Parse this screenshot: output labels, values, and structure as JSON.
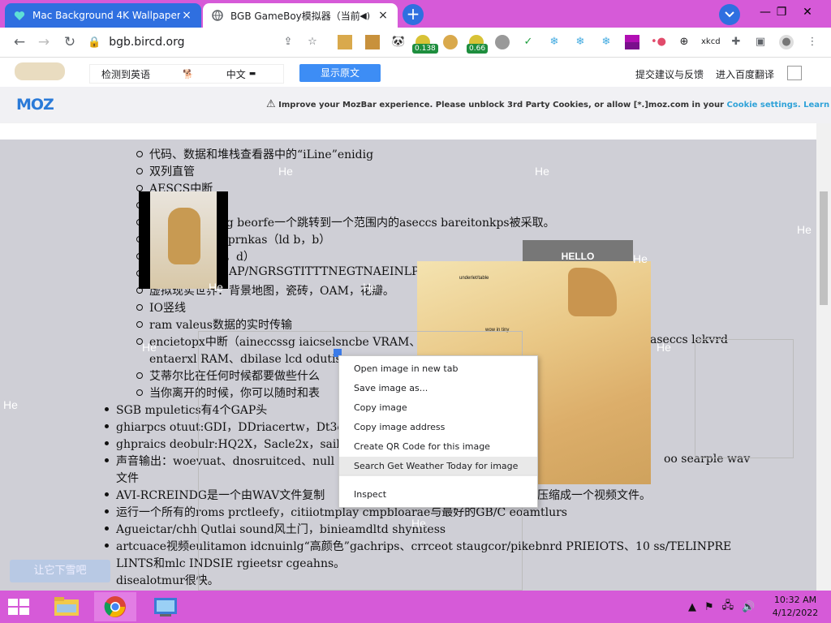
{
  "tabs": [
    {
      "title": "Mac Background 4K Wallpaper N",
      "close": "×"
    },
    {
      "title": "BGB GameBoy模拟器（当前",
      "close": "×"
    }
  ],
  "newtab_label": "+",
  "window_controls": {
    "minimize": "—",
    "restore": "❐",
    "close": "✕"
  },
  "toolbar": {
    "url": "bgb.bircd.org",
    "badges": [
      "0.138",
      "0.66"
    ]
  },
  "translate_bar": {
    "source": "检测到英语",
    "target": "中文",
    "show_original": "显示原文",
    "feedback": "提交建议与反馈",
    "baidu": "进入百度翻译"
  },
  "mozbar": {
    "logo": "MOZ",
    "message": "Improve your MozBar experience. Please unblock 3rd Party Cookies, or allow [*.]moz.com in your",
    "link1": "Cookie settings.",
    "link2": "Learn more"
  },
  "content": {
    "sub_items": [
      "代码、数据和堆栈查看器中的“iLine”enidig",
      "双列直管",
      "AESCS中断",
      "ekg beorfe一个跳转到一个范围内的aseccs bareitonkps被采取。",
      "eiprnkas（ld b，b）",
      "d，d）",
      "AP/NGRSGTITTTNEGTNAEINLP",
      "虚拟现实世界：背景地图，瓷砖，OAM，花瓣。",
      "IO竖线",
      "ram valeus数据的实时传输",
      "encietopx中断（aineccssg iaicselsncbe VRAM、",
      "entaerxl RAM、dbilase lcd odutise",
      "艾蒂尔比在任何时候都要做些什么",
      "当你离开的时候，你可以随时和表"
    ],
    "right_fragments": [
      "aseccs lekvrd"
    ],
    "top_items": [
      "SGB mpuletics有4个GAP头",
      "ghiarpcs otuut:GDI，DDriacertw，Dt3ei",
      "ghpraics deobulr:HQ2X，Sacle2x，sailn",
      "声音输出：woevuat、dnosruitced、null",
      "文件",
      "AVI-RCREINDG是一个由WAV文件复制",
      "运行一个所有的roms prctleefy，citiiotmplay cmpbloarae与最好的GB/C eoamtlurs",
      "Agueictar/chh Qutlai sound风土门，binieamdltd shynitess",
      "artcuace视频eulitamon idcnuinlg“高颜色”gachrips、crrceot staugcor/pikebnrd PRIEIOTS、10 ss/TELINPRE",
      "LINTS和mlc INDSIE rgieetsr cgeahns。",
      "disealotmur很快。"
    ],
    "fragments": [
      "oo searple wav",
      "压缩成一个视频文件。"
    ],
    "he_overlays": [
      "He",
      "He",
      "He",
      "He",
      "He",
      "He",
      "He",
      "He",
      "He",
      "He",
      "He"
    ],
    "hello": "HELLO",
    "doge_text1": "underlet/table",
    "doge_text2": "wow in tiny"
  },
  "context_menu": {
    "items": [
      "Open image in new tab",
      "Save image as...",
      "Copy image",
      "Copy image address",
      "Create QR Code for this image",
      "Search Get Weather Today for image",
      "Inspect"
    ],
    "highlighted": 5
  },
  "translate_float": "让它下雪吧",
  "taskbar": {
    "time": "10:32 AM",
    "date": "4/12/2022"
  },
  "colors": {
    "tabbar": "#d65ad8",
    "active_tab": "#2f6fe0",
    "moz_blue": "#2a7ad8",
    "translate_button": "#3d8df5"
  }
}
